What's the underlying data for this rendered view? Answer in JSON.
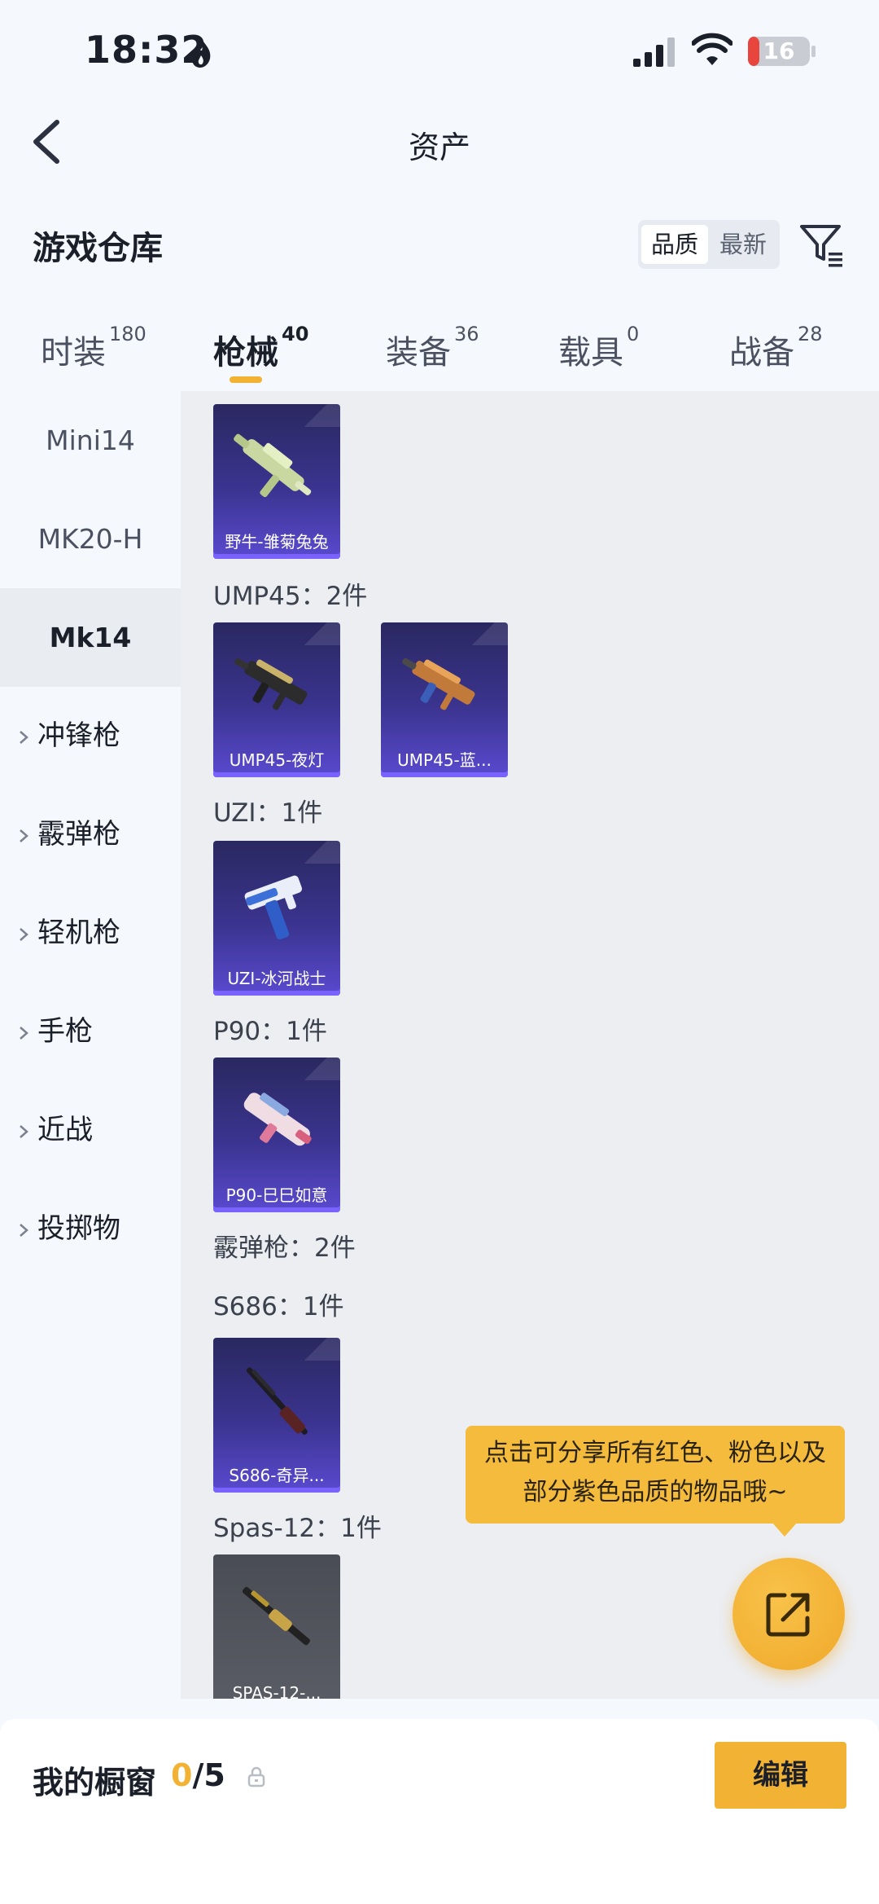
{
  "status_bar": {
    "time": "18:32",
    "battery": "16"
  },
  "nav": {
    "title": "资产"
  },
  "warehouse": {
    "title": "游戏仓库",
    "sort_options": [
      "品质",
      "最新"
    ],
    "sort_selected": "品质"
  },
  "tabs": [
    {
      "label": "时装",
      "count": "180"
    },
    {
      "label": "枪械",
      "count": "40"
    },
    {
      "label": "装备",
      "count": "36"
    },
    {
      "label": "载具",
      "count": "0"
    },
    {
      "label": "战备",
      "count": "28"
    }
  ],
  "active_tab": "枪械",
  "sidebar": {
    "subitems": [
      "Mini14",
      "MK20-H",
      "Mk14"
    ],
    "selected": "Mk14",
    "groups": [
      "冲锋枪",
      "霰弹枪",
      "轻机枪",
      "手枪",
      "近战",
      "投掷物"
    ]
  },
  "content": {
    "sections": [
      {
        "label": "UMP45：2件"
      },
      {
        "label": "UZI：1件"
      },
      {
        "label": "P90：1件"
      },
      {
        "label": "霰弹枪：2件"
      },
      {
        "label": "S686：1件"
      },
      {
        "label": "Spas-12：1件"
      }
    ],
    "cards": [
      {
        "name": "野牛-雏菊兔兔"
      },
      {
        "name": "UMP45-夜灯"
      },
      {
        "name": "UMP45-蓝..."
      },
      {
        "name": "UZI-冰河战士"
      },
      {
        "name": "P90-巳巳如意"
      },
      {
        "name": "S686-奇异..."
      },
      {
        "name": "SPAS-12-..."
      }
    ]
  },
  "tooltip": {
    "line1": "点击可分享所有红色、粉色以及",
    "line2": "部分紫色品质的物品哦~"
  },
  "bottom_bar": {
    "label": "我的橱窗",
    "current": "0",
    "separator_total": "/5",
    "edit_label": "编辑"
  },
  "colors": {
    "accent": "#f2b233",
    "card_purple": "#3b3490",
    "card_grey": "#5b5d66"
  },
  "icons": [
    "flame-icon",
    "signal-icon",
    "wifi-icon",
    "battery-icon",
    "back-icon",
    "filter-icon",
    "share-icon",
    "lock-icon"
  ]
}
